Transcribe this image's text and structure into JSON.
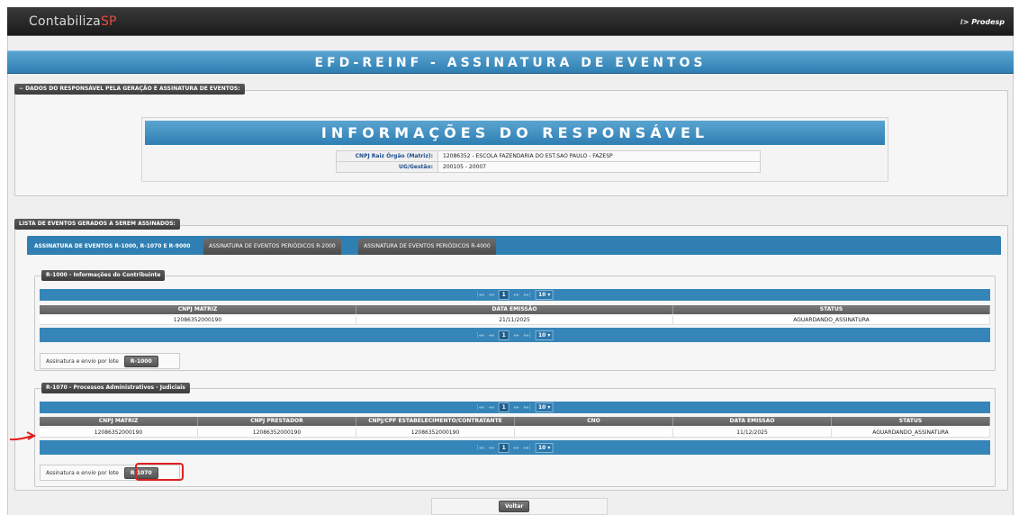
{
  "app": {
    "logo_main": "Contabiliza",
    "logo_accent": "SP",
    "vendor": "Prodesp",
    "vendor_icon": "sparkle-icon"
  },
  "page_title": "EFD-REINF - ASSINATURA DE EVENTOS",
  "responsavel": {
    "legend": "DADOS DO RESPONSÁVEL PELA GERAÇÃO E ASSINATURA DE EVENTOS:",
    "title": "INFORMAÇÕES DO RESPONSÁVEL",
    "rows": [
      {
        "label": "CNPJ Raiz Órgão (Matriz):",
        "value": "12086352 - ESCOLA FAZENDARIA DO EST.SAO PAULO - FAZESP"
      },
      {
        "label": "UG/Gestão:",
        "value": "200105 - 20007"
      }
    ]
  },
  "lista": {
    "legend": "LISTA DE EVENTOS GERADOS A SEREM ASSINADOS:"
  },
  "tabs": [
    {
      "label": "ASSINATURA DE EVENTOS R-1000, R-1070 E R-9000",
      "active": true
    },
    {
      "label": "ASSINATURA DE EVENTOS PERIÓDICOS R-2000",
      "active": false
    },
    {
      "label": "ASSINATURA DE EVENTOS PERIÓDICOS R-4000",
      "active": false
    }
  ],
  "pager": {
    "first": "|◂◂",
    "prev": "◂◂",
    "page": "1",
    "next": "▸▸",
    "last": "▸▸|",
    "page_size": "10"
  },
  "r1000": {
    "legend": "R-1000 - Informações do Contribuinte",
    "columns": [
      "CNPJ MATRIZ",
      "DATA EMISSÃO",
      "STATUS"
    ],
    "rows": [
      [
        "12086352000190",
        "21/11/2025",
        "AGUARDANDO_ASSINATURA"
      ]
    ],
    "lote_label": "Assinatura e envio por lote",
    "lote_button": "R-1000"
  },
  "r1070": {
    "legend": "R-1070 - Processos Administrativos - Judiciais",
    "columns": [
      "CNPJ MATRIZ",
      "CNPJ PRESTADOR",
      "CNPJ/CPF ESTABELECIMENTO/CONTRATANTE",
      "CNO",
      "DATA EMISSAO",
      "STATUS"
    ],
    "rows": [
      [
        "12086352000190",
        "12086352000190",
        "12086352000190",
        "",
        "11/12/2025",
        "AGUARDANDO_ASSINATURA"
      ]
    ],
    "lote_label": "Assinatura e envio por lote",
    "lote_button": "R-1070"
  },
  "footer": {
    "voltar": "Voltar"
  },
  "colors": {
    "accent_blue": "#2f7fb3",
    "header_gray": "#5e5e5e",
    "annotation_red": "#e02020"
  }
}
